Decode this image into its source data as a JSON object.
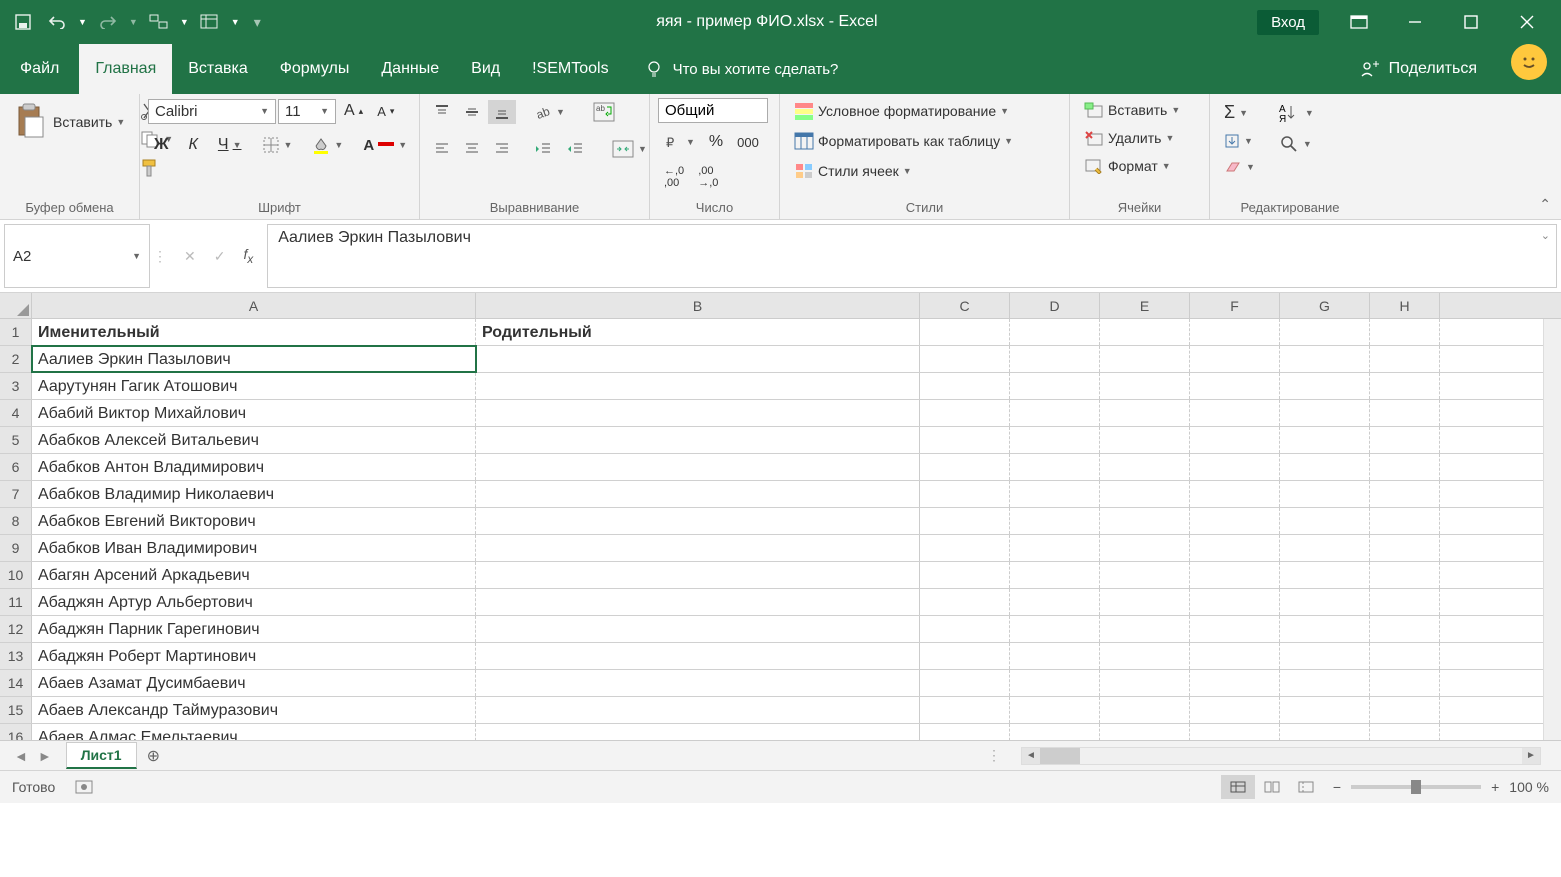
{
  "title": "яяя - пример ФИО.xlsx  -  Excel",
  "login": "Вход",
  "tabs": {
    "file": "Файл",
    "items": [
      "Главная",
      "Вставка",
      "Формулы",
      "Данные",
      "Вид",
      "!SEMTools"
    ],
    "active": "Главная",
    "tellme": "Что вы хотите сделать?",
    "share": "Поделиться"
  },
  "ribbon": {
    "clipboard": {
      "paste": "Вставить",
      "label": "Буфер обмена"
    },
    "font": {
      "name": "Calibri",
      "size": "11",
      "label": "Шрифт",
      "bold": "Ж",
      "italic": "К",
      "underline": "Ч"
    },
    "alignment": {
      "label": "Выравнивание",
      "wrap_ab": "ab"
    },
    "number": {
      "format": "Общий",
      "label": "Число",
      "thousands": "000"
    },
    "styles": {
      "label": "Стили",
      "conditional": "Условное форматирование",
      "as_table": "Форматировать как таблицу",
      "cell_styles": "Стили ячеек"
    },
    "cells": {
      "label": "Ячейки",
      "insert": "Вставить",
      "delete": "Удалить",
      "format": "Формат"
    },
    "editing": {
      "label": "Редактирование"
    }
  },
  "namebox": "A2",
  "formula": "Аалиев Эркин Пазылович",
  "columns": [
    "A",
    "B",
    "C",
    "D",
    "E",
    "F",
    "G",
    "H"
  ],
  "rows": [
    {
      "n": 1,
      "A": "Именительный",
      "B": "Родительный",
      "bold": true
    },
    {
      "n": 2,
      "A": "Аалиев Эркин Пазылович",
      "B": "",
      "active": true
    },
    {
      "n": 3,
      "A": "Аарутунян Гагик Атошович",
      "B": ""
    },
    {
      "n": 4,
      "A": "Абабий Виктор Михайлович",
      "B": ""
    },
    {
      "n": 5,
      "A": "Абабков Алексей Витальевич",
      "B": ""
    },
    {
      "n": 6,
      "A": "Абабков Антон Владимирович",
      "B": ""
    },
    {
      "n": 7,
      "A": "Абабков Владимир Николаевич",
      "B": ""
    },
    {
      "n": 8,
      "A": "Абабков Евгений Викторович",
      "B": ""
    },
    {
      "n": 9,
      "A": "Абабков Иван Владимирович",
      "B": ""
    },
    {
      "n": 10,
      "A": "Абагян Арсений Аркадьевич",
      "B": ""
    },
    {
      "n": 11,
      "A": "Абаджян Артур Альбертович",
      "B": ""
    },
    {
      "n": 12,
      "A": "Абаджян Парник Гарегинович",
      "B": ""
    },
    {
      "n": 13,
      "A": "Абаджян Роберт Мартинович",
      "B": ""
    },
    {
      "n": 14,
      "A": "Абаев Азамат Дусимбаевич",
      "B": ""
    },
    {
      "n": 15,
      "A": "Абаев Александр Таймуразович",
      "B": ""
    },
    {
      "n": 16,
      "A": "Абаев Алмас Емельтаевич",
      "B": ""
    }
  ],
  "sheet": "Лист1",
  "status": "Готово",
  "zoom": "100 %"
}
